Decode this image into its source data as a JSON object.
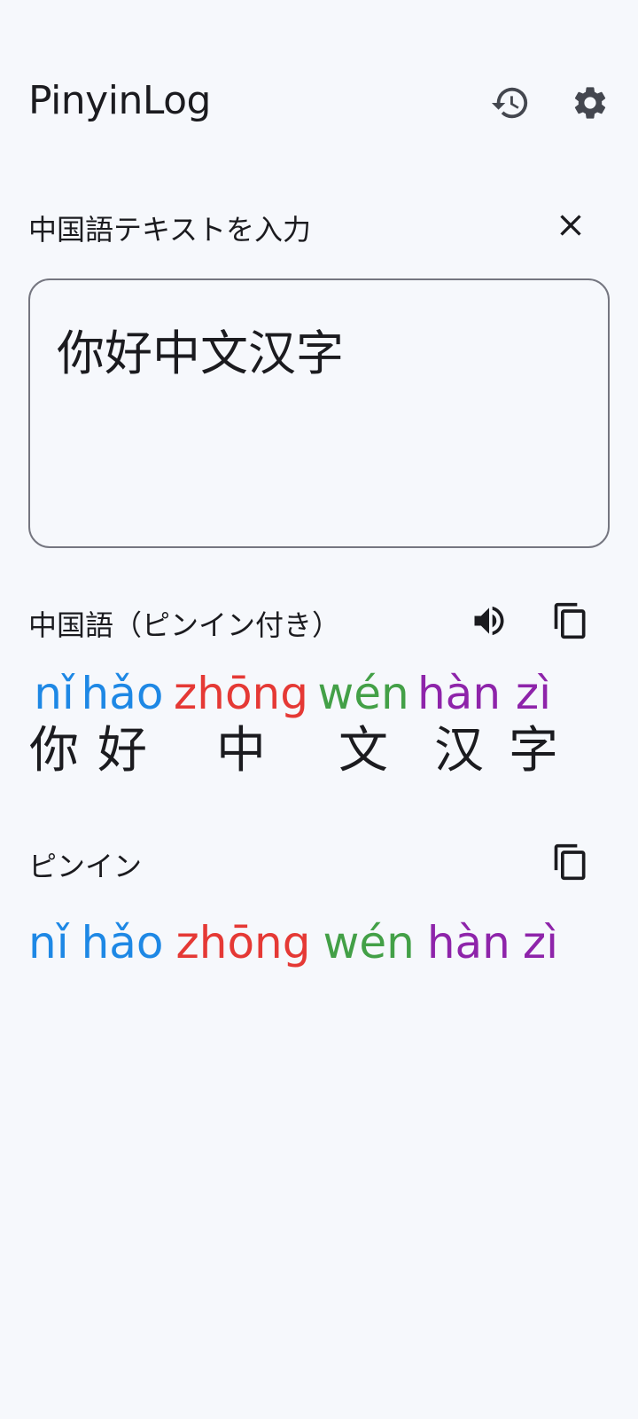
{
  "app_bar": {
    "title": "PinyinLog",
    "history_icon": "history-icon",
    "settings_icon": "gear-icon"
  },
  "input": {
    "label": "中国語テキストを入力",
    "value": "你好中文汉字",
    "clear_icon": "close-icon"
  },
  "ruby_section": {
    "label": "中国語（ピンイン付き）",
    "speak_icon": "volume-icon",
    "copy_icon": "copy-icon",
    "words": [
      {
        "pinyin": "nǐ",
        "hanzi": "你",
        "color": "#1e88e5"
      },
      {
        "pinyin": "hǎo",
        "hanzi": "好",
        "color": "#1e88e5"
      },
      {
        "pinyin": "zhōng",
        "hanzi": "中",
        "color": "#e53935"
      },
      {
        "pinyin": "wén",
        "hanzi": "文",
        "color": "#43a047"
      },
      {
        "pinyin": "hàn",
        "hanzi": "汉",
        "color": "#8e24aa"
      },
      {
        "pinyin": "zì",
        "hanzi": "字",
        "color": "#8e24aa"
      }
    ]
  },
  "pinyin_section": {
    "label": "ピンイン",
    "copy_icon": "copy-icon",
    "syllables": [
      {
        "text": "nǐ",
        "color": "#1e88e5"
      },
      {
        "text": "hǎo",
        "color": "#1e88e5"
      },
      {
        "text": "zhōng",
        "color": "#e53935"
      },
      {
        "text": "wén",
        "color": "#43a047"
      },
      {
        "text": "hàn",
        "color": "#8e24aa"
      },
      {
        "text": "zì",
        "color": "#8e24aa"
      }
    ]
  },
  "colors": {
    "background": "#f6f8fc",
    "text": "#1b1b1f",
    "icon": "#44474f",
    "outline": "#757680"
  }
}
